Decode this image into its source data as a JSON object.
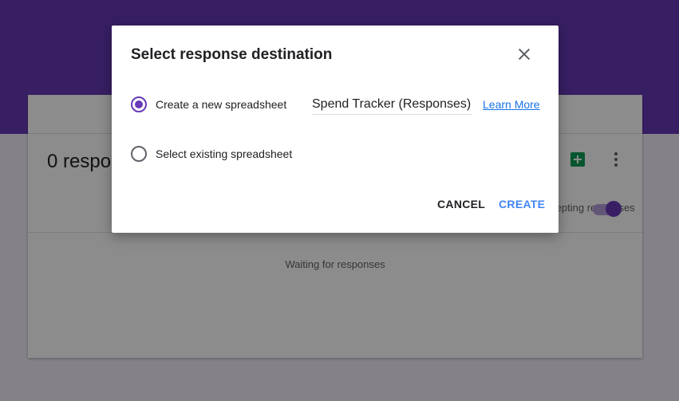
{
  "background": {
    "response_count": "0 responses",
    "accepting_label": "Accepting responses",
    "waiting_text": "Waiting for responses",
    "accepting_toggle_on": true
  },
  "dialog": {
    "title": "Select response destination",
    "options": [
      {
        "label": "Create a new spreadsheet",
        "checked": true
      },
      {
        "label": "Select existing spreadsheet",
        "checked": false
      }
    ],
    "spreadsheet_name": "Spend Tracker (Responses)",
    "learn_more": "Learn More",
    "cancel_label": "CANCEL",
    "create_label": "CREATE"
  },
  "colors": {
    "accent": "#673ab7",
    "sheets_green": "#0f9d58",
    "link_blue": "#1a73e8",
    "create_blue": "#4285f4"
  },
  "icons": [
    "close-icon",
    "sheets-icon",
    "more-vert-icon",
    "radio-button-checked",
    "radio-button-unchecked"
  ]
}
